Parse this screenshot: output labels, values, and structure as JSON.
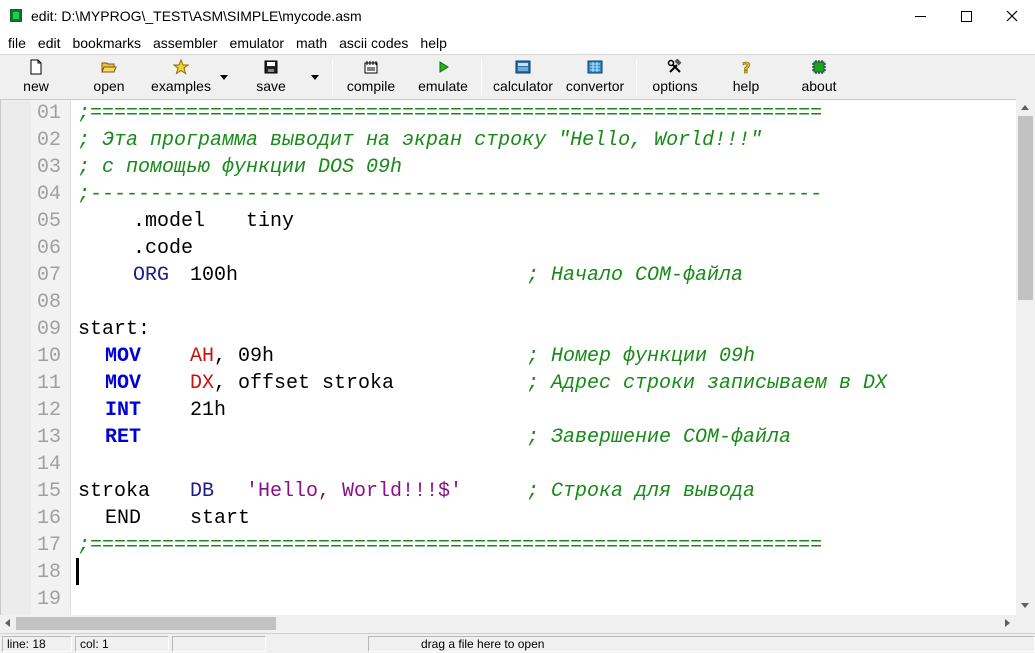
{
  "window": {
    "title": "edit: D:\\MYPROG\\_TEST\\ASM\\SIMPLE\\mycode.asm"
  },
  "menu": [
    "file",
    "edit",
    "bookmarks",
    "assembler",
    "emulator",
    "math",
    "ascii codes",
    "help"
  ],
  "toolbar": {
    "new": "new",
    "open": "open",
    "examples": "examples",
    "save": "save",
    "compile": "compile",
    "emulate": "emulate",
    "calculator": "calculator",
    "convertor": "convertor",
    "options": "options",
    "help": "help",
    "about": "about"
  },
  "editor": {
    "line_numbers": [
      "01",
      "02",
      "03",
      "04",
      "05",
      "06",
      "07",
      "08",
      "09",
      "10",
      "11",
      "12",
      "13",
      "14",
      "15",
      "16",
      "17",
      "18",
      "19"
    ],
    "l01": ";=============================================================",
    "l02": "; Эта программа выводит на экран строку \"Hello, World!!!\"",
    "l03": "; с помощью функции DOS 09h",
    "l04": ";-------------------------------------------------------------",
    "l05_dir": ".model",
    "l05_arg": "tiny",
    "l06_dir": ".code",
    "l07_kw": "ORG",
    "l07_arg": "100h",
    "l07_com": "; Начало COM-файла",
    "l09": "start:",
    "l10_kw": "MOV",
    "l10_reg": "AH",
    "l10_arg": ", 09h",
    "l10_com": "; Номер функции 09h",
    "l11_kw": "MOV",
    "l11_reg": "DX",
    "l11_arg": ", offset stroka",
    "l11_com": "; Адрес строки записываем в DX",
    "l12_kw": "INT",
    "l12_arg": "21h",
    "l13_kw": "RET",
    "l13_com": "; Завершение COM-файла",
    "l15_label": "stroka",
    "l15_kw": "DB",
    "l15_str": "'Hello, World!!!$'",
    "l15_com": "; Строка для вывода",
    "l16_kw": "END",
    "l16_arg": "start",
    "l17": ";============================================================="
  },
  "status": {
    "line": "line: 18",
    "col": "col: 1",
    "hint": "drag a file here to open"
  }
}
